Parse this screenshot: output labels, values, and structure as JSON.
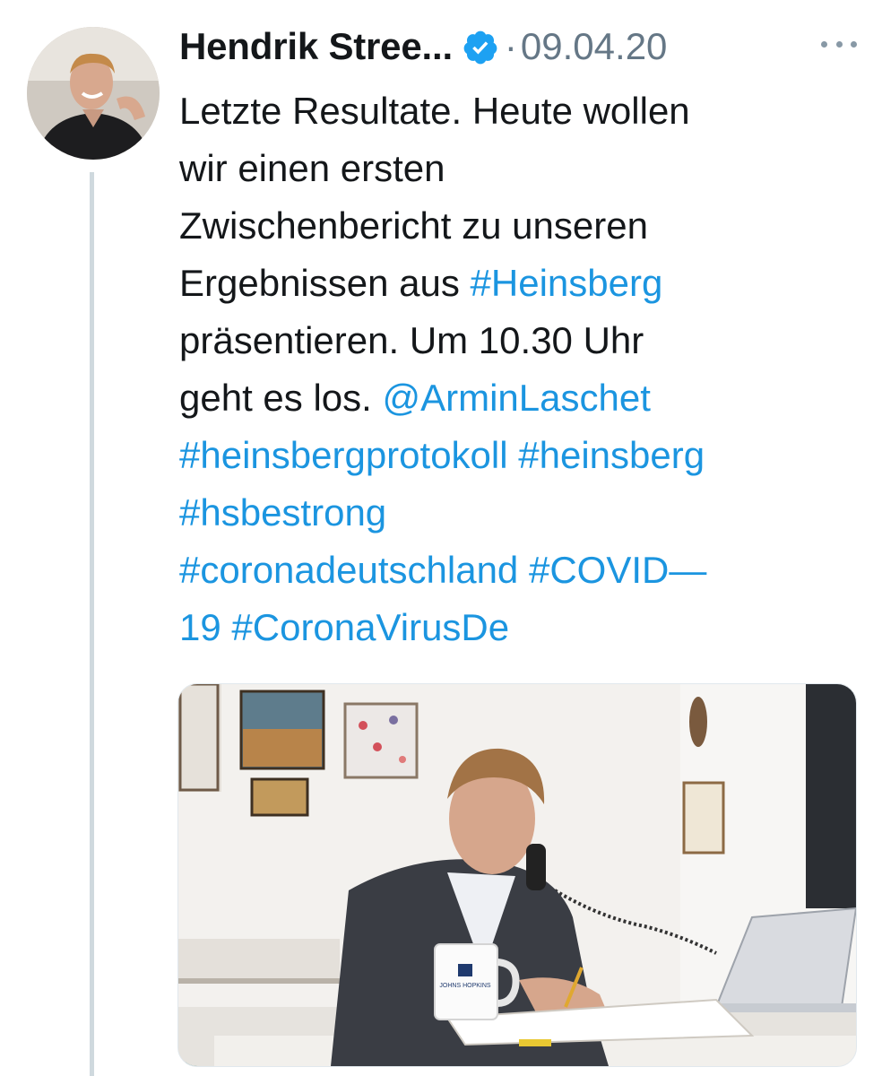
{
  "tweet": {
    "author_name": "Hendrik Stree...",
    "separator": "·",
    "date": "09.04.20",
    "body": {
      "l1": "Letzte Resultate. Heute wollen",
      "l2": "wir einen ersten",
      "l3": "Zwischenbericht zu unseren",
      "l4_text": "Ergebnissen aus ",
      "l4_tag": "#Heinsberg",
      "l5": "präsentieren. Um 10.30 Uhr",
      "l6_text": "geht es los. ",
      "l6_mention": "@ArminLaschet",
      "l7_tag1": "#heinsbergprotokoll",
      "l7_tag2": "#heinsberg",
      "l8_tag": "#hsbestrong",
      "l9_tag1": "#coronadeutschland",
      "l9_tag2": "#COVID—",
      "l10_tag1": "19",
      "l10_tag2": "#CoronaVirusDe"
    },
    "mug_text": "JOHNS HOPKINS"
  },
  "colors": {
    "link": "#1b95e0",
    "text": "#14171a",
    "muted": "#657786",
    "verified": "#1da1f2",
    "thread_line": "#cfd9de"
  },
  "icons": {
    "verified": "verified-badge-icon",
    "more": "more-horizontal-icon"
  }
}
